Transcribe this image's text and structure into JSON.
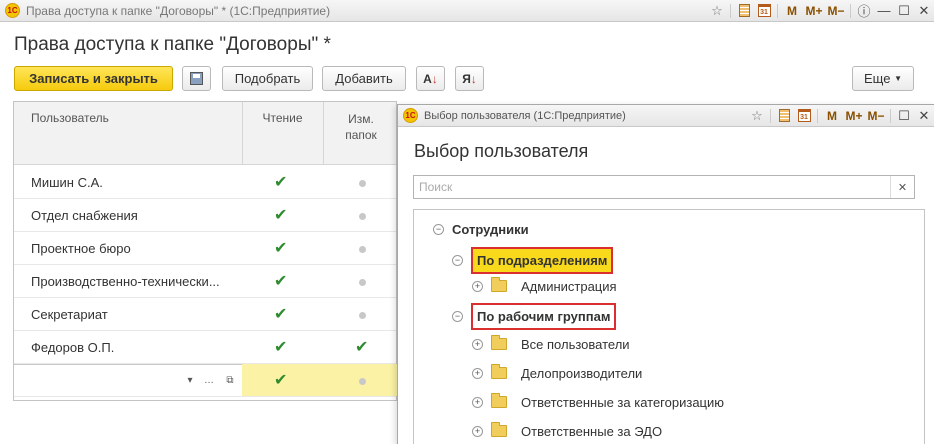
{
  "main": {
    "window_title": "Права доступа к папке \"Договоры\" * (1С:Предприятие)",
    "page_title": "Права доступа к папке \"Договоры\" *",
    "toolbar": {
      "save_close": "Записать и закрыть",
      "pick": "Подобрать",
      "add": "Добавить",
      "more": "Еще"
    },
    "table": {
      "columns": {
        "users": "Пользователь",
        "read": "Чтение",
        "edit_line1": "Изм.",
        "edit_line2": "папок"
      },
      "rows": [
        {
          "name": "Мишин С.А.",
          "read": true,
          "edit": false
        },
        {
          "name": "Отдел снабжения",
          "read": true,
          "edit": false
        },
        {
          "name": "Проектное бюро",
          "read": true,
          "edit": false
        },
        {
          "name": "Производственно-технически...",
          "read": true,
          "edit": false
        },
        {
          "name": "Секретариат",
          "read": true,
          "edit": false
        },
        {
          "name": "Федоров О.П.",
          "read": true,
          "edit": true
        }
      ],
      "edit_row": {
        "name": "",
        "read": true,
        "edit": false
      }
    }
  },
  "dialog": {
    "window_title": "Выбор пользователя (1С:Предприятие)",
    "title": "Выбор пользователя",
    "search_placeholder": "Поиск",
    "tree": {
      "root": "Сотрудники",
      "by_departments": "По подразделениям",
      "departments": [
        "Администрация"
      ],
      "by_groups": "По рабочим группам",
      "groups": [
        "Все пользователи",
        "Делопроизводители",
        "Ответственные за категоризацию",
        "Ответственные за ЭДО"
      ]
    }
  },
  "colors": {
    "accent_yellow": "#f6cb0d",
    "highlight_red": "#d9302f",
    "check_green": "#2e8b2e"
  },
  "tools": {
    "m": "M",
    "m_plus": "M+",
    "m_minus": "M−"
  }
}
